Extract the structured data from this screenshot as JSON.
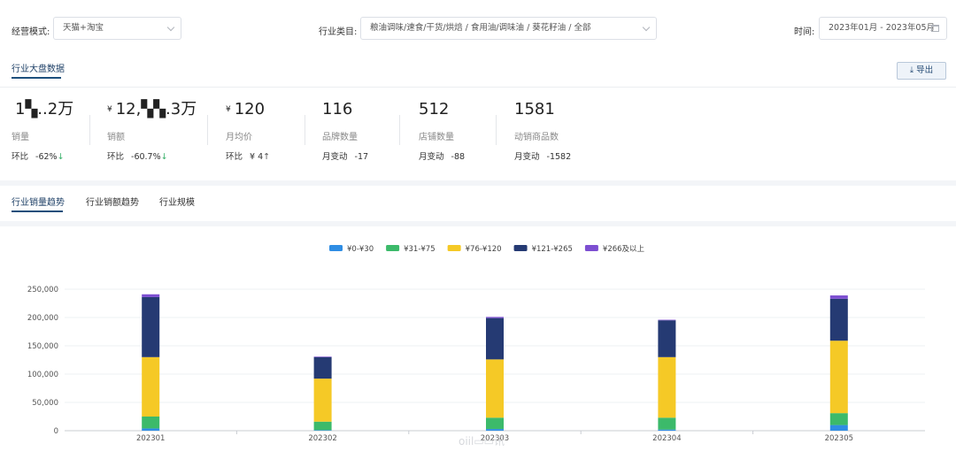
{
  "filters": {
    "mode_label": "经营模式:",
    "mode_value": "天猫+淘宝",
    "category_label": "行业类目:",
    "category_value": "粮油调味/速食/干货/烘焙 / 食用油/调味油 / 葵花籽油 / 全部",
    "time_label": "时间:",
    "time_value": "2023年01月 - 2023年05月"
  },
  "overview": {
    "title": "行业大盘数据",
    "export_label": "导出",
    "kpis": [
      {
        "currency": "",
        "value": "1▚..2万",
        "name": "销量",
        "sub_label": "环比",
        "sub_value": "-62%",
        "arrow": "↓",
        "trend": "down"
      },
      {
        "currency": "¥",
        "value": "12,▚▚.3万",
        "name": "销额",
        "sub_label": "环比",
        "sub_value": "-60.7%",
        "arrow": "↓",
        "trend": "down"
      },
      {
        "currency": "¥",
        "value": "120",
        "name": "月均价",
        "sub_label": "环比",
        "sub_value": "¥ 4",
        "arrow": "↑",
        "trend": "up"
      },
      {
        "currency": "",
        "value": "116",
        "name": "品牌数量",
        "sub_label": "月变动",
        "sub_value": "-17",
        "arrow": "",
        "trend": ""
      },
      {
        "currency": "",
        "value": "512",
        "name": "店铺数量",
        "sub_label": "月变动",
        "sub_value": "-88",
        "arrow": "",
        "trend": ""
      },
      {
        "currency": "",
        "value": "1581",
        "name": "动销商品数",
        "sub_label": "月变动",
        "sub_value": "-1582",
        "arrow": "",
        "trend": ""
      }
    ]
  },
  "tabs": [
    "行业销量趋势",
    "行业销额趋势",
    "行业规模"
  ],
  "watermark": "oiil▭▭讯",
  "chart_data": {
    "type": "bar",
    "stacked": true,
    "categories": [
      "202301",
      "202302",
      "202303",
      "202304",
      "202305"
    ],
    "series": [
      {
        "name": "¥0-¥30",
        "color": "#2f8de4",
        "values": [
          4000,
          1000,
          3000,
          2000,
          10000
        ]
      },
      {
        "name": "¥31-¥75",
        "color": "#3cba6a",
        "values": [
          21000,
          15000,
          20000,
          21000,
          21000
        ]
      },
      {
        "name": "¥76-¥120",
        "color": "#f5c926",
        "values": [
          105000,
          76000,
          103000,
          107000,
          128000
        ]
      },
      {
        "name": "¥121-¥265",
        "color": "#253a73",
        "values": [
          106000,
          38000,
          73000,
          65000,
          74000
        ]
      },
      {
        "name": "¥266及以上",
        "color": "#7d4fd1",
        "values": [
          5000,
          1000,
          2000,
          1000,
          6000
        ]
      }
    ],
    "ylim": [
      0,
      250000
    ],
    "yticks": [
      "0",
      "50,000",
      "100,000",
      "150,000",
      "200,000",
      "250,000"
    ],
    "grid": true,
    "legend_position": "top-center"
  }
}
